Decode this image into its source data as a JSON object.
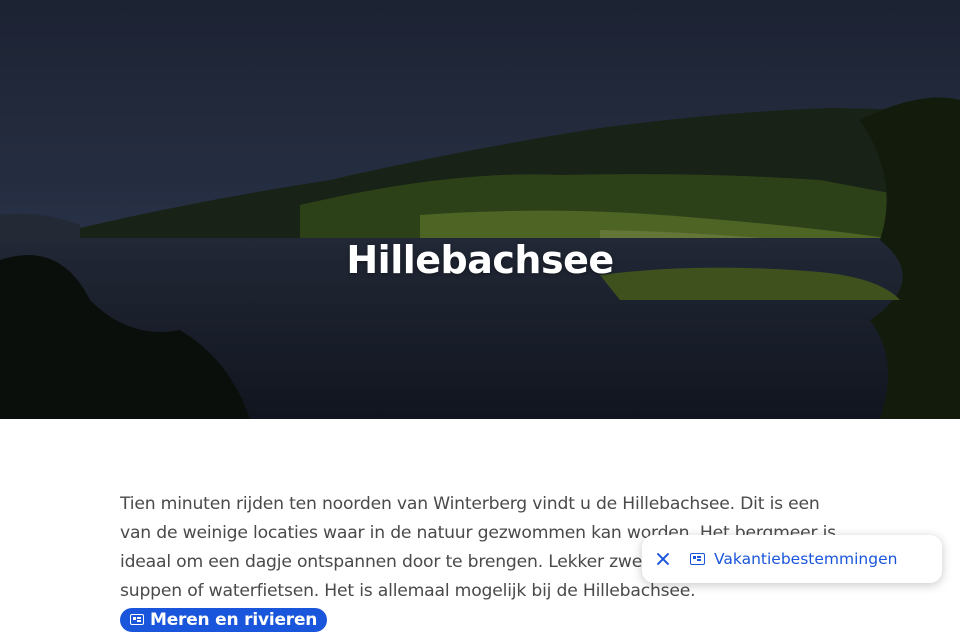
{
  "hero": {
    "title": "Hillebachsee",
    "image_subject": "lake-landscape"
  },
  "article": {
    "text": "Tien minuten rijden ten noorden van Winterberg vindt u de Hillebachsee. Dit is een van de weinige locaties waar in de natuur gezwommen kan worden. Het bergmeer is ideaal om een dagje ontspannen door te brengen. Lekker zwemmen, zonnen, vissen, suppen of waterfietsen. Het is allemaal mogelijk bij de Hillebachsee.",
    "category_chip": "Meren en rivieren"
  },
  "toast": {
    "label": "Vakantiebestemmingen",
    "close_icon": "close-icon",
    "icon": "newspaper-icon"
  },
  "colors": {
    "accent": "#1a56db",
    "body_text": "#4a4a4a",
    "hero_overlay": "#1b2233"
  }
}
